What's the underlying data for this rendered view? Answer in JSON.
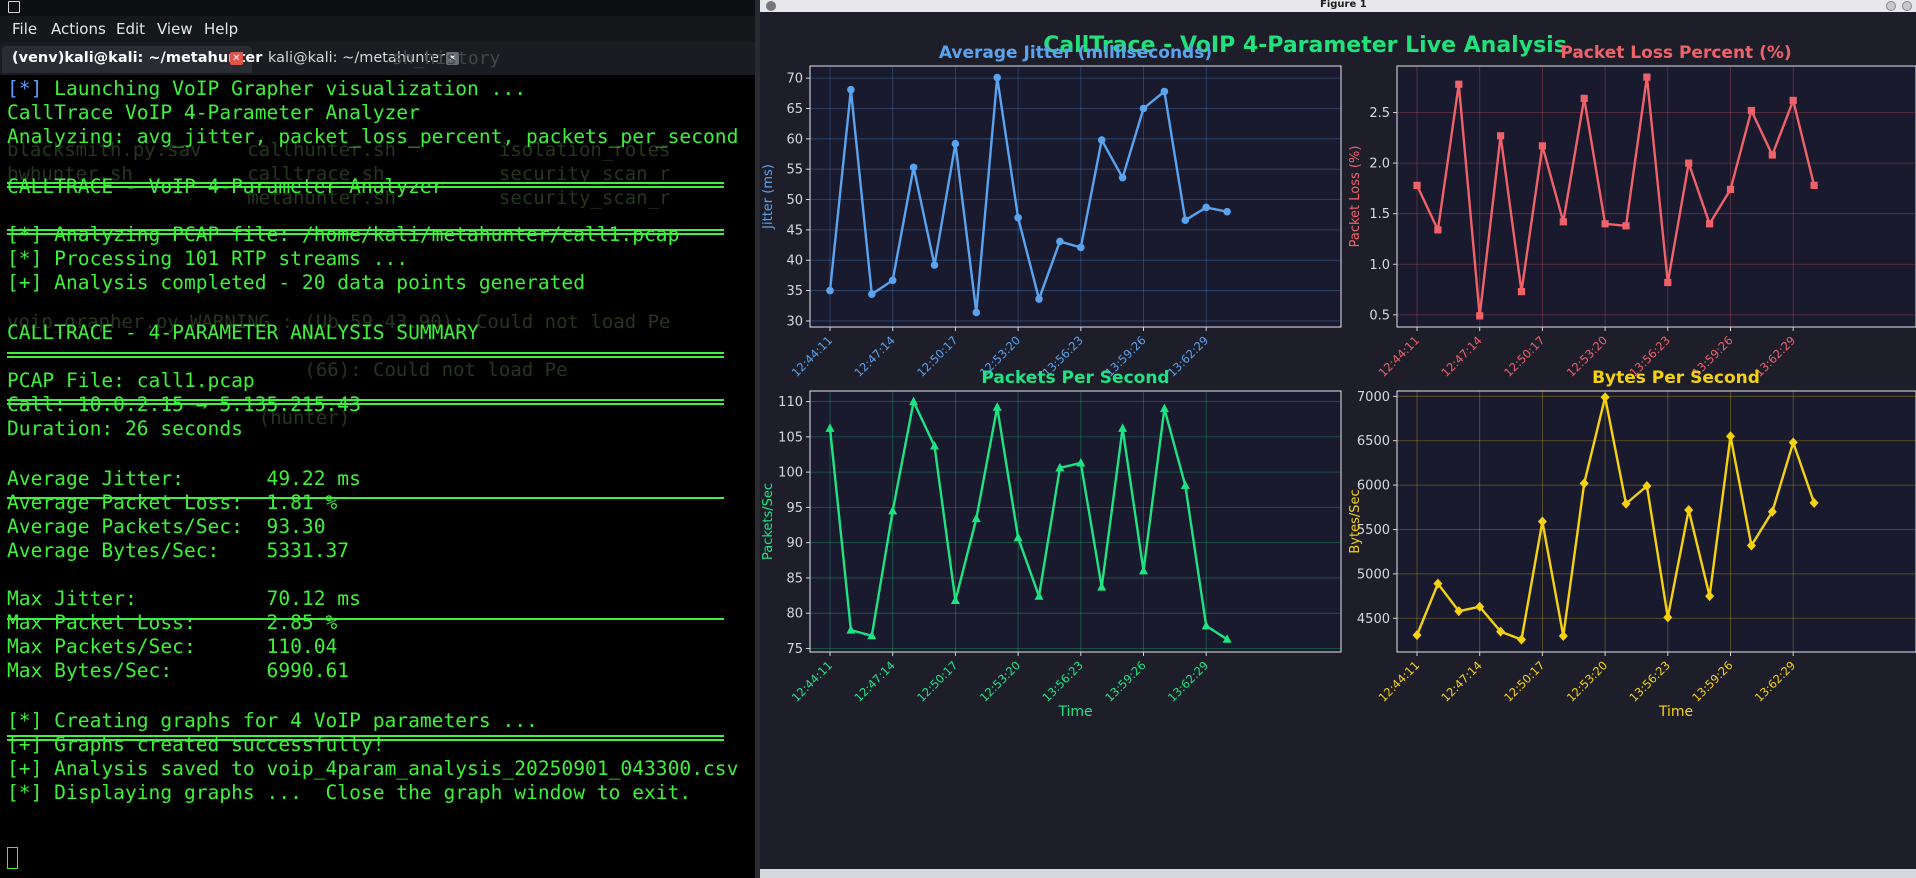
{
  "terminal": {
    "menu": [
      "File",
      "Actions",
      "Edit",
      "View",
      "Help"
    ],
    "tabs": [
      {
        "label": "(venv)kali@kali: ~/metahunter",
        "close": "✕"
      },
      {
        "label": "kali@kali: ~/metahunter",
        "close": "✕"
      }
    ],
    "ghost_tab_text": "sh_history",
    "lines": {
      "launch_prefix": "[*]",
      "launch_text": " Launching VoIP Grapher visualization ...",
      "analyzer": "CallTrace VoIP 4-Parameter Analyzer",
      "analyzing": "Analyzing: avg_jitter, packet_loss_percent, packets_per_second",
      "header1": "CALLTRACE - VoIP 4-Parameter Analyzer",
      "pcap_line": "[*] Analyzing PCAP file: /home/kali/metahunter/call1.pcap",
      "rtp_line": "[*] Processing 101 RTP streams ...",
      "done_line": "[+] Analysis completed - 20 data points generated",
      "header2": "CALLTRACE - 4-PARAMETER ANALYSIS SUMMARY",
      "pcap_file": "PCAP File: call1.pcap",
      "call": "Call: 10.0.2.15 → 5.135.215.43",
      "duration": "Duration: 26 seconds",
      "avg_jitter": "Average Jitter:       49.22 ms",
      "avg_loss": "Average Packet Loss:  1.81 %",
      "avg_pps": "Average Packets/Sec:  93.30",
      "avg_bps": "Average Bytes/Sec:    5331.37",
      "max_jitter": "Max Jitter:           70.12 ms",
      "max_loss": "Max Packet Loss:      2.85 %",
      "max_pps": "Max Packets/Sec:      110.04",
      "max_bps": "Max Bytes/Sec:        6990.61",
      "creating": "[*] Creating graphs for 4 VoIP parameters ...",
      "created": "[+] Graphs created successfully!",
      "saved": "[+] Analysis saved to voip_4param_analysis_20250901_043300.csv",
      "displaying": "[*] Displaying graphs ...  Close the graph window to exit."
    },
    "ghost_lines": [
      "blacksmith.py.sav    callhunter.sh         isolation_roles",
      "bwhunter.sh          calltrace.sh          security_scan_r",
      "                     metahunter.sh         security_scan_r",
      "voip_grapher.py WARNING : (Ub.59.43.90): Could not load Pe",
      "                          (66): Could not load Pe",
      "                      (hunter)"
    ]
  },
  "figure": {
    "window_title": "Figure 1",
    "suptitle": "CallTrace - VoIP 4-Parameter Live Analysis",
    "colors": {
      "background": "#1e1e2b",
      "axes_bg": "#1a1a2e",
      "jitter": "#5aa3ef",
      "loss": "#f0626a",
      "pps": "#1ee383",
      "bps": "#f5d20f",
      "title_green": "#22e07b"
    }
  },
  "chart_data": [
    {
      "type": "line",
      "title": "Average Jitter (milliseconds)",
      "xlabel": "",
      "ylabel": "Jitter (ms)",
      "color": "#5aa3ef",
      "marker": "circle",
      "x_ticklabels": [
        "12:44:11",
        "12:47:14",
        "12:50:17",
        "12:53:20",
        "13:56:23",
        "13:59:26",
        "13:62:29"
      ],
      "ylim": [
        29,
        72
      ],
      "yticks": [
        30,
        35,
        40,
        45,
        50,
        55,
        60,
        65,
        70
      ],
      "values": [
        35.0,
        68.1,
        34.4,
        36.7,
        55.3,
        39.2,
        59.2,
        31.4,
        70.1,
        47.0,
        33.6,
        43.1,
        42.1,
        59.8,
        53.6,
        65.0,
        67.8,
        46.6,
        48.7,
        48.0
      ]
    },
    {
      "type": "line",
      "title": "Packet Loss Percent (%)",
      "xlabel": "",
      "ylabel": "Packet Loss (%)",
      "color": "#f0626a",
      "marker": "square",
      "x_ticklabels": [
        "12:44:11",
        "12:47:14",
        "12:50:17",
        "12:53:20",
        "13:56:23",
        "13:59:26",
        "13:62:29"
      ],
      "ylim": [
        0.38,
        2.96
      ],
      "yticks": [
        0.5,
        1.0,
        1.5,
        2.0,
        2.5
      ],
      "values": [
        1.78,
        1.34,
        2.78,
        0.49,
        2.27,
        0.73,
        2.17,
        1.42,
        2.64,
        1.4,
        1.38,
        2.85,
        0.82,
        2.0,
        1.4,
        1.74,
        2.52,
        2.08,
        2.62,
        1.78
      ]
    },
    {
      "type": "line",
      "title": "Packets Per Second",
      "xlabel": "Time",
      "ylabel": "Packets/Sec",
      "color": "#1ee383",
      "marker": "triangle",
      "x_ticklabels": [
        "12:44:11",
        "12:47:14",
        "12:50:17",
        "12:53:20",
        "13:56:23",
        "13:59:26",
        "13:62:29"
      ],
      "ylim": [
        74.5,
        111.5
      ],
      "yticks": [
        75,
        80,
        85,
        90,
        95,
        100,
        105,
        110
      ],
      "values": [
        106.2,
        77.6,
        76.8,
        94.5,
        110.0,
        103.7,
        81.8,
        93.4,
        109.2,
        90.7,
        82.4,
        100.6,
        101.3,
        83.7,
        106.2,
        86.0,
        109.0,
        98.1,
        78.2,
        76.3
      ]
    },
    {
      "type": "line",
      "title": "Bytes Per Second",
      "xlabel": "Time",
      "ylabel": "Bytes/Sec",
      "color": "#f5d20f",
      "marker": "diamond",
      "x_ticklabels": [
        "12:44:11",
        "12:47:14",
        "12:50:17",
        "12:53:20",
        "13:56:23",
        "13:59:26",
        "13:62:29"
      ],
      "ylim": [
        4120,
        7060
      ],
      "yticks": [
        4500,
        5000,
        5500,
        6000,
        6500,
        7000
      ],
      "values": [
        4310,
        4890,
        4580,
        4630,
        4350,
        4260,
        5590,
        4300,
        6020,
        6990,
        5790,
        5990,
        4510,
        5720,
        4750,
        6550,
        5320,
        5700,
        6480,
        5800
      ]
    }
  ]
}
